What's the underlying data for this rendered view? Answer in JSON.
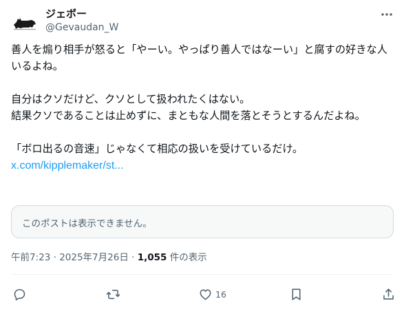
{
  "author": {
    "display_name": "ジェボー",
    "handle": "@Gevaudan_W",
    "avatar_icon": "wolf-silhouette-icon"
  },
  "more_icon": "ellipsis-icon",
  "tweet": {
    "paragraph1": "善人を煽り相手が怒ると「やーい。やっぱり善人ではなーい」と腐すの好きな人いるよね。",
    "paragraph2_line1": "自分はクソだけど、クソとして扱われたくはない。",
    "paragraph2_line2": "結果クソであることは止めずに、まともな人間を落とそうとするんだよね。",
    "paragraph3": "「ボロ出るの音速」じゃなくて相応の扱いを受けているだけ。",
    "link": "x.com/kipplemaker/st..."
  },
  "quote": {
    "unavailable_text": "このポストは表示できません。"
  },
  "meta": {
    "time": "午前7:23",
    "separator1": " · ",
    "date": "2025年7月26日",
    "separator2": " · ",
    "view_count": "1,055",
    "view_label": " 件の表示"
  },
  "actions": {
    "reply_icon": "reply-icon",
    "repost_icon": "repost-icon",
    "like_icon": "heart-icon",
    "like_count": "16",
    "bookmark_icon": "bookmark-icon",
    "share_icon": "share-icon"
  },
  "colors": {
    "link": "#1d9bf0",
    "secondary_text": "#536471",
    "primary_text": "#0f1419",
    "border": "#cfd9de",
    "quote_bg": "#f7f9f9"
  }
}
